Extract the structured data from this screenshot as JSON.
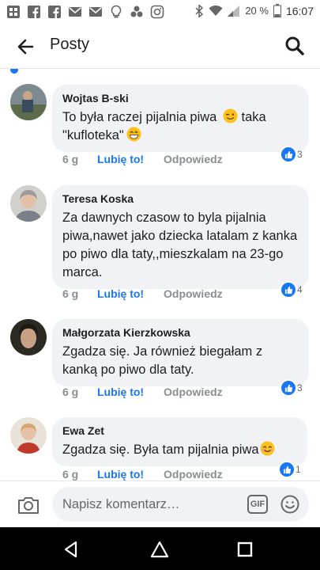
{
  "status_bar": {
    "battery_percent": "20 %",
    "time": "16:07"
  },
  "header": {
    "title": "Posty"
  },
  "comments": [
    {
      "author": "Wojtas B-ski",
      "text": "To była raczej pijalnia piwa",
      "text_after_emoji": " taka \"kufloteka\"",
      "age": "6 g",
      "like_label": "Lubię to!",
      "reply_label": "Odpowiedz",
      "reaction_count": "3"
    },
    {
      "author": "Teresa Koska",
      "text": "Za dawnych  czasow to byla pijalnia piwa,nawet jako dziecka latalam z kanka po piwo dla taty,,mieszkalam na 23-go marca.",
      "age": "6 g",
      "like_label": "Lubię to!",
      "reply_label": "Odpowiedz",
      "reaction_count": "4"
    },
    {
      "author": "Małgorzata Kierzkowska",
      "text": "Zgadza się. Ja również biegałam z kanką po piwo dla taty.",
      "age": "6 g",
      "like_label": "Lubię to!",
      "reply_label": "Odpowiedz",
      "reaction_count": "3"
    },
    {
      "author": "Ewa Zet",
      "text": "Zgadza się. Była tam pijalnia piwa",
      "age": "6 g",
      "like_label": "Lubię to!",
      "reply_label": "Odpowiedz",
      "reaction_count": "1"
    }
  ],
  "composer": {
    "placeholder": "Napisz komentarz…",
    "gif_label": "GIF"
  },
  "colors": {
    "accent": "#1877f2",
    "bubble": "#f0f2f5",
    "meta_gray": "#8a8d91"
  },
  "icons": [
    "back-arrow-icon",
    "search-icon",
    "camera-icon",
    "gif-icon",
    "emoji-icon",
    "like-thumb-icon",
    "nav-back-icon",
    "nav-home-icon",
    "nav-recents-icon"
  ]
}
